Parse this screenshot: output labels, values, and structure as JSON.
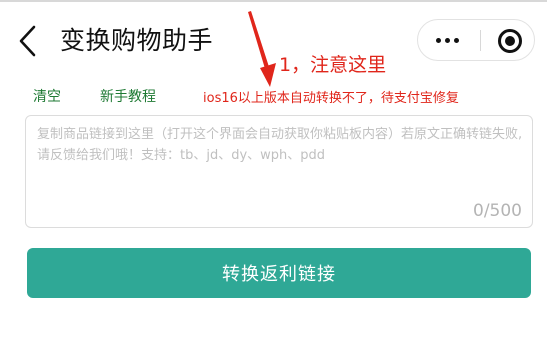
{
  "header": {
    "title": "变换购物助手",
    "back_icon": "chevron-left-icon",
    "more_icon": "more-dots-icon",
    "close_icon": "mini-program-close-icon"
  },
  "annotation": {
    "text": "1，注意这里",
    "color": "#e0261b"
  },
  "toolbar": {
    "clear_label": "清空",
    "tutorial_label": "新手教程",
    "notice": "ios16以上版本自动转换不了，待支付宝修复",
    "link_color": "#1f7a34"
  },
  "input": {
    "value": "",
    "placeholder": "复制商品链接到这里（打开这个界面会自动获取你粘贴板内容）若原文正确转链失败,请反馈给我们哦！支持：tb、jd、dy、wph、pdd",
    "counter": "0/500"
  },
  "action": {
    "convert_label": "转换返利链接",
    "color": "#2fa896"
  }
}
